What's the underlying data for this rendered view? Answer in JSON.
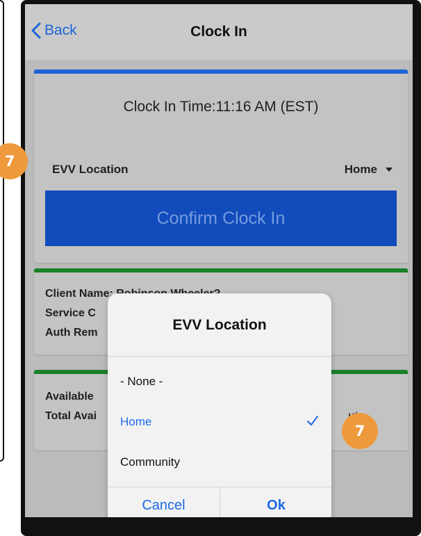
{
  "nav": {
    "back_label": "Back",
    "title": "Clock In"
  },
  "clock_card": {
    "clock_in_time": "Clock In Time:11:16 AM (EST)",
    "evv_label": "EVV Location",
    "evv_value": "Home",
    "confirm_label": "Confirm Clock In"
  },
  "client_card": {
    "line1": "Client Name: Robinson Wheeler?",
    "line2": "Service C",
    "line3": "Auth Rem"
  },
  "avail_card": {
    "line1": "Available",
    "line2": "Total Avai",
    "line2_tail": "ut"
  },
  "dialog": {
    "title": "EVV Location",
    "options": [
      {
        "label": "- None -",
        "selected": false
      },
      {
        "label": "Home",
        "selected": true
      },
      {
        "label": "Community",
        "selected": false
      }
    ],
    "cancel_label": "Cancel",
    "ok_label": "Ok"
  },
  "badges": {
    "step_left": "7",
    "step_right": "7"
  },
  "colors": {
    "accent_blue": "#1e6be6",
    "confirm_blue": "#1350c8",
    "green": "#1b8a2c",
    "badge_orange": "#ee9a3c"
  }
}
